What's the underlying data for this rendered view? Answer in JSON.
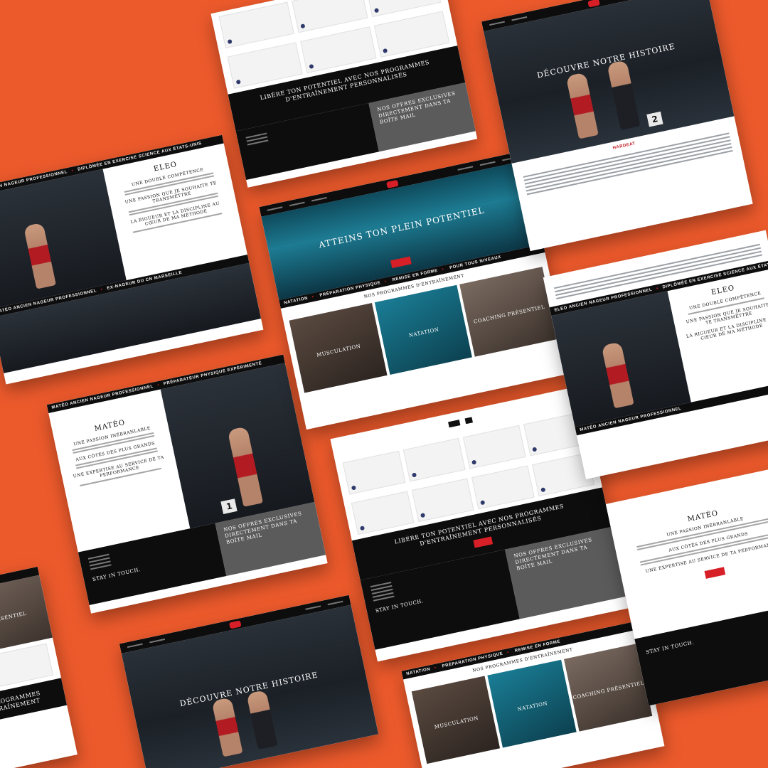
{
  "tickers": {
    "eleo": "ELEO ANCIEN NAGEUR PROFESSIONNEL",
    "eleo_diploma": "DIPLÔMÉE EN EXERCISE SCIENCE AUX ÉTATS-UNIS",
    "mateo": "MATÉO ANCIEN NAGEUR PROFESSIONNEL",
    "mateo_marseille": "EX-NAGEUR DU CN MARSEILLE",
    "mateo_prep": "PRÉPARATEUR PHYSIQUE EXPÉRIMENTÉ",
    "categories": [
      "NATATION",
      "PRÉPARATION PHYSIQUE",
      "REMISE EN FORME",
      "POUR TOUS NIVEAUX"
    ]
  },
  "hero": {
    "title": "ATTEINS TON PLEIN POTENTIEL",
    "story": "DÉCOUVRE NOTRE HISTOIRE"
  },
  "programs": {
    "title": "NOS PROGRAMMES D'ENTRAÎNEMENT",
    "items": [
      "MUSCULATION",
      "NATATION",
      "COACHING PRÉSENTIEL"
    ]
  },
  "cta": {
    "title": "LIBÈRE TON POTENTIEL AVEC NOS PROGRAMMES D'ENTRAÎNEMENT PERSONNALISÉS"
  },
  "footer": {
    "offers": "NOS OFFRES EXCLUSIVES DIRECTEMENT DANS TA BOÎTE MAIL",
    "stay": "STAY IN TOUCH."
  },
  "eleo": {
    "name": "ELEO",
    "s1": "UNE DOUBLE COMPÉTENCE",
    "s2": "UNE PASSION QUE JE SOUHAITE TE TRANSMETTRE",
    "s3": "LA RIGUEUR ET LA DISCIPLINE AU CŒUR DE MA MÉTHODE"
  },
  "mateo": {
    "name": "MATÉO",
    "s1": "UNE PASSION INÉBRANLABLE",
    "s2": "AUX CÔTÉS DES PLUS GRANDS",
    "s3": "UNE EXPERTISE AU SERVICE DE TA PERFORMANCE"
  },
  "brand": {
    "logo_text": "HARDEAT"
  },
  "colors": {
    "background": "#ec5a2c",
    "accent": "#d61f26",
    "dark": "#0d0d0d"
  }
}
